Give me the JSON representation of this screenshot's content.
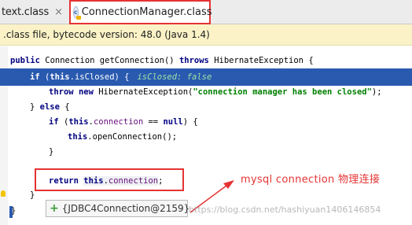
{
  "tabs": [
    {
      "label": "text.class",
      "close": "×"
    },
    {
      "icon_letter": "c",
      "label": "ConnectionManager.class",
      "close": "×"
    }
  ],
  "banner": {
    "text": ".class file, bytecode version: 48.0 (Java 1.4)"
  },
  "code": {
    "line1": {
      "kw1": "public",
      "t1": " Connection getConnection() ",
      "kw2": "throws",
      "t2": " HibernateException {"
    },
    "line2": {
      "kw1": "if",
      "t1": " (",
      "kw2": "this",
      "t2": ".",
      "fld": "isClosed",
      "t3": ") {",
      "hint": "isClosed: false"
    },
    "line3": {
      "kw1": "throw",
      "t1": " ",
      "kw2": "new",
      "t2": " HibernateException(",
      "str": "\"connection manager has been closed\"",
      "t3": ");"
    },
    "line4": {
      "t1": "} ",
      "kw1": "else",
      "t2": " {"
    },
    "line5": {
      "kw1": "if",
      "t1": " (",
      "kw2": "this",
      "t2": ".",
      "fld": "connection",
      "t3": " == ",
      "kw3": "null",
      "t4": ") {"
    },
    "line6": {
      "kw1": "this",
      "t1": ".openConnection();"
    },
    "line7": {
      "t1": "}"
    },
    "line8": {
      "kw1": "return",
      "t1": " ",
      "kw2": "this",
      "t2": ".",
      "fld": "connection",
      "t3": ";"
    },
    "line9": {
      "t1": "}"
    },
    "line10": {
      "t1": "}"
    }
  },
  "annotation": {
    "text": "mysql connection 物理连接"
  },
  "popup": {
    "icon": "+",
    "text": "{JDBC4Connection@2159}"
  },
  "watermark": {
    "text": "https://blog.csdn.net/hashiyuan1406146854"
  },
  "colors": {
    "highlight_box": "#e53333",
    "execution_line": "#2a5ab0",
    "banner_bg": "#fbf3c7"
  }
}
